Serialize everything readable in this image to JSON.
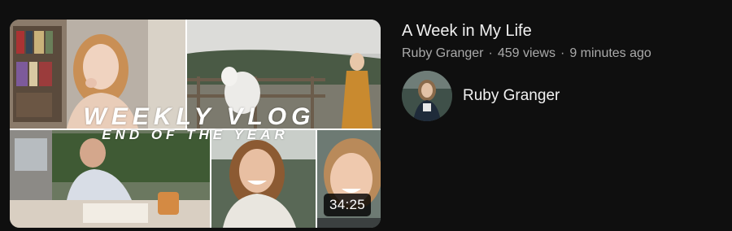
{
  "video": {
    "title": "A Week in My Life",
    "channel": "Ruby Granger",
    "views": "459 views",
    "separator": "·",
    "uploaded": "9 minutes ago",
    "duration": "34:25"
  },
  "thumbnail": {
    "headline": "WEEKLY VLOG",
    "subheadline": "END OF THE YEAR"
  },
  "channel_row": {
    "name": "Ruby Granger",
    "avatar_icon": "channel-avatar"
  },
  "colors": {
    "background": "#0f0f0f",
    "title_text": "#f1f1f1",
    "meta_text": "#aaaaaa",
    "duration_badge": "#000000"
  }
}
